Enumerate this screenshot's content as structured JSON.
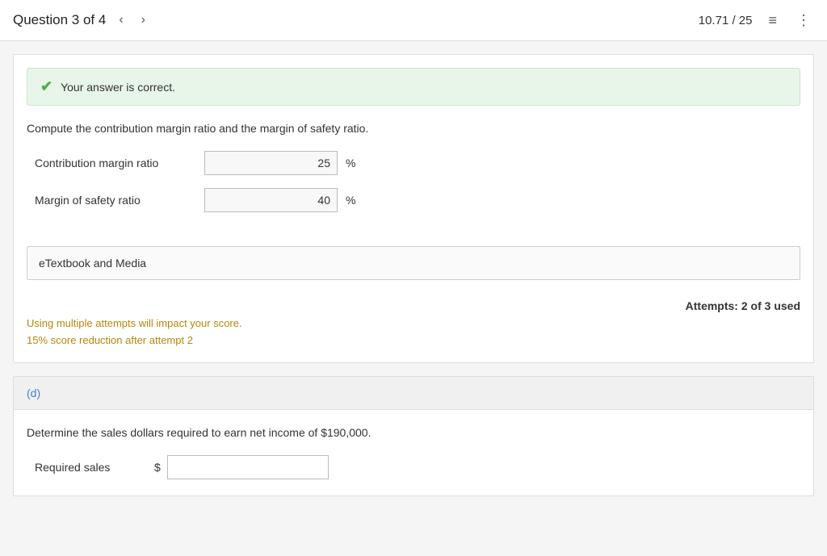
{
  "header": {
    "question_title": "Question 3 of 4",
    "score": "10.71 / 25",
    "prev_label": "‹",
    "next_label": "›",
    "list_icon": "≡",
    "more_icon": "⋮"
  },
  "correct_banner": {
    "message": "Your answer is correct."
  },
  "question_c": {
    "text": "Compute the contribution margin ratio and the margin of safety ratio.",
    "fields": [
      {
        "label": "Contribution margin ratio",
        "value": "25",
        "unit": "%"
      },
      {
        "label": "Margin of safety ratio",
        "value": "40",
        "unit": "%"
      }
    ]
  },
  "etextbook": {
    "label": "eTextbook and Media"
  },
  "attempts": {
    "text": "Attempts: 2 of 3 used"
  },
  "warning": {
    "line1": "Using multiple attempts will impact your score.",
    "line2": "15% score reduction after attempt 2"
  },
  "part_d": {
    "label": "(d)",
    "question": "Determine the sales dollars required to earn net income of $190,000.",
    "field_label": "Required sales",
    "dollar_sign": "$",
    "value": ""
  }
}
